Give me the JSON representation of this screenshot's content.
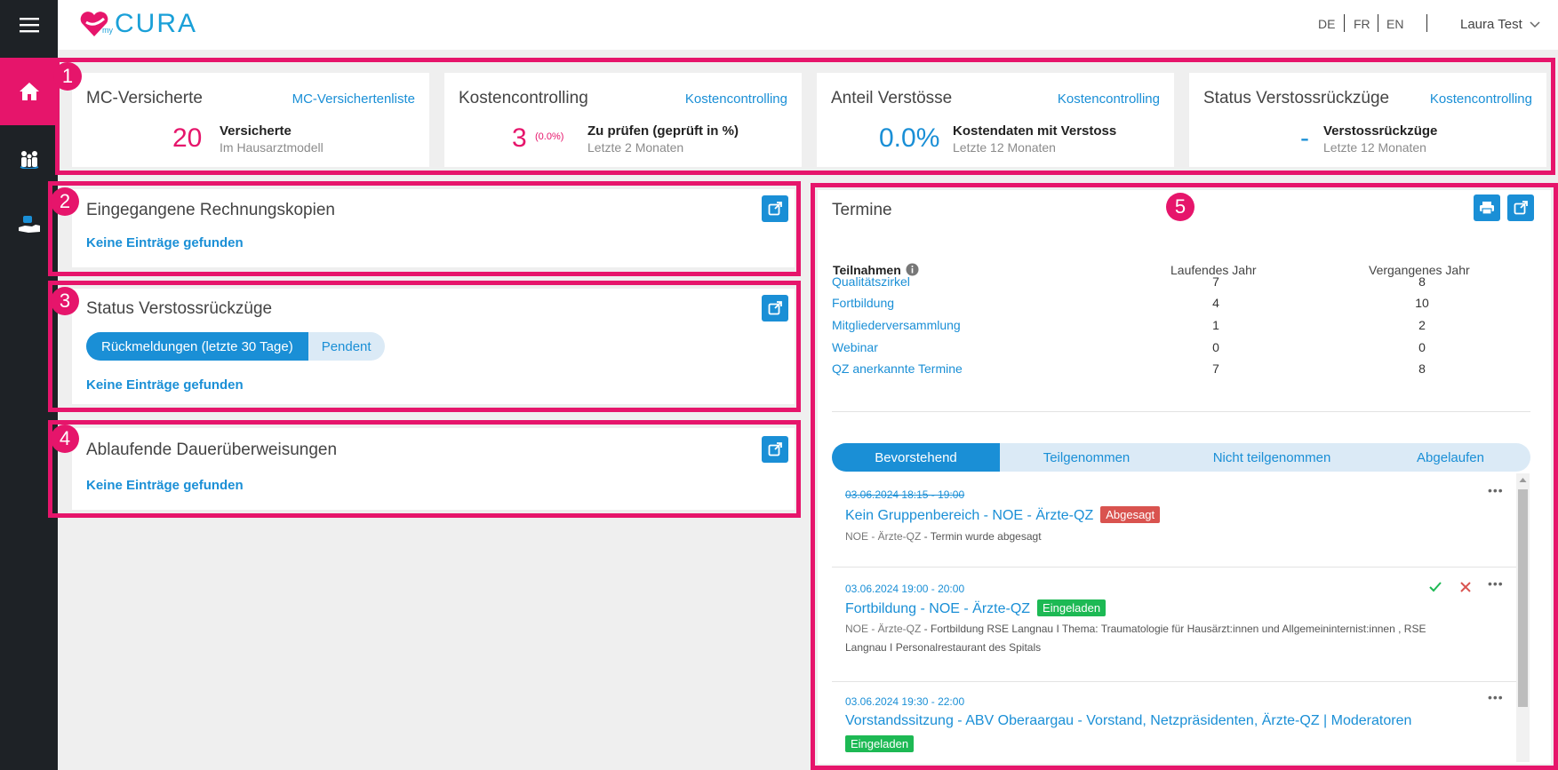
{
  "app": {
    "logo_small": "my",
    "logo_text": "CURA"
  },
  "languages": [
    "DE",
    "FR",
    "EN"
  ],
  "user": {
    "name": "Laura Test"
  },
  "kpis": [
    {
      "badge": "1",
      "title": "MC-Versicherte",
      "link": "MC-Versichertenliste",
      "value": "20",
      "sub": "",
      "label": "Versicherte",
      "note": "Im Hausarztmodell",
      "color": "#e6156b"
    },
    {
      "title": "Kostencontrolling",
      "link": "Kostencontrolling",
      "value": "3",
      "sub": "(0.0%)",
      "label": "Zu prüfen (geprüft in %)",
      "note": "Letzte 2 Monaten",
      "color": "#e6156b"
    },
    {
      "title": "Anteil Verstösse",
      "link": "Kostencontrolling",
      "value": "0.0%",
      "sub": "",
      "label": "Kostendaten mit Verstoss",
      "note": "Letzte 12 Monaten",
      "color": "#1a8fd6"
    },
    {
      "title": "Status Verstossrückzüge",
      "link": "Kostencontrolling",
      "value": "-",
      "sub": "",
      "label": "Verstossrückzüge",
      "note": "Letzte 12 Monaten",
      "color": "#1a8fd6"
    }
  ],
  "panels": {
    "rechnungskopien": {
      "badge": "2",
      "title": "Eingegangene Rechnungskopien",
      "empty": "Keine Einträge gefunden"
    },
    "verstoss": {
      "badge": "3",
      "title": "Status Verstossrückzüge",
      "toggle_on": "Rückmeldungen (letzte 30 Tage)",
      "toggle_off": "Pendent",
      "empty": "Keine Einträge gefunden"
    },
    "dauer": {
      "badge": "4",
      "title": "Ablaufende Dauerüberweisungen",
      "empty": "Keine Einträge gefunden"
    }
  },
  "termine": {
    "badge": "5",
    "title": "Termine",
    "stats_header": {
      "label": "Teilnahmen",
      "current": "Laufendes Jahr",
      "previous": "Vergangenes Jahr"
    },
    "stats": [
      {
        "label": "Qualitätszirkel",
        "current": "7",
        "previous": "8"
      },
      {
        "label": "Fortbildung",
        "current": "4",
        "previous": "10"
      },
      {
        "label": "Mitgliederversammlung",
        "current": "1",
        "previous": "2"
      },
      {
        "label": "Webinar",
        "current": "0",
        "previous": "0"
      },
      {
        "label": "QZ anerkannte Termine",
        "current": "7",
        "previous": "8"
      }
    ],
    "tabs": [
      "Bevorstehend",
      "Teilgenommen",
      "Nicht teilgenommen",
      "Abgelaufen"
    ],
    "events": [
      {
        "date": "03.06.2024 18:15 - 19:00",
        "title": "Kein Gruppenbereich - NOE - Ärzte-QZ",
        "status": "Abgesagt",
        "status_color": "#d9534f",
        "org": "NOE - Ärzte-QZ",
        "desc": "Termin wurde abgesagt"
      },
      {
        "date": "03.06.2024 19:00 - 20:00",
        "title": "Fortbildung - NOE - Ärzte-QZ",
        "status": "Eingeladen",
        "status_color": "#1db954",
        "org": "NOE - Ärzte-QZ",
        "desc": "Fortbildung RSE Langnau I Thema: Traumatologie für Hausärzt:innen und Allgemeininternist:innen , RSE Langnau I Personalrestaurant des Spitals"
      },
      {
        "date": "03.06.2024 19:30 - 22:00",
        "title": "Vorstandssitzung - ABV Oberaargau - Vorstand, Netzpräsidenten, Ärzte-QZ | Moderatoren",
        "status": "Eingeladen",
        "status_color": "#1db954",
        "org": "",
        "desc": ""
      }
    ]
  }
}
